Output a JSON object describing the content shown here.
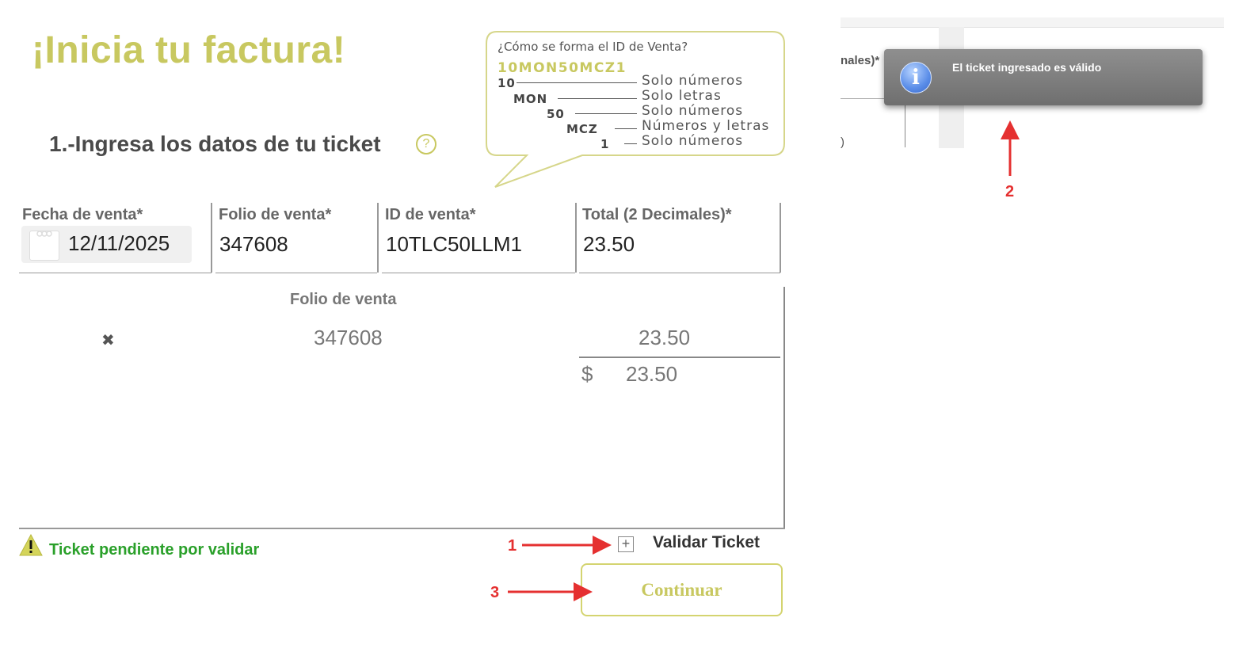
{
  "page": {
    "title": "¡Inicia tu factura!",
    "section_title": "1.-Ingresa los datos de tu ticket",
    "help_icon": "question-circle-icon"
  },
  "id_help": {
    "question": "¿Cómo se forma el ID de Venta?",
    "example": "10MON50MCZ1",
    "parts": [
      {
        "part": "10",
        "desc": "Solo números"
      },
      {
        "part": "MON",
        "desc": "Solo letras"
      },
      {
        "part": "50",
        "desc": "Solo números"
      },
      {
        "part": "MCZ",
        "desc": "Números y letras"
      },
      {
        "part": "1",
        "desc": "Solo números"
      }
    ]
  },
  "form": {
    "fecha": {
      "label": "Fecha de venta*",
      "value": "12/11/2025",
      "icon": "calendar-icon"
    },
    "folio": {
      "label": "Folio de venta*",
      "value": "347608"
    },
    "id_venta": {
      "label": "ID de venta*",
      "value": "10TLC50LLM1"
    },
    "total": {
      "label": "Total (2 Decimales)*",
      "value": "23.50"
    }
  },
  "table": {
    "header_folio": "Folio de venta",
    "rows": [
      {
        "delete_icon": "close-icon",
        "folio": "347608",
        "total": "23.50"
      }
    ],
    "sum_currency": "$",
    "sum_total": "23.50"
  },
  "status": {
    "icon": "warning-icon",
    "text": "Ticket pendiente por validar"
  },
  "actions": {
    "validate_icon": "plus-square-icon",
    "validate_label": "Validar Ticket",
    "continue_label": "Continuar"
  },
  "annotations": {
    "one": "1",
    "two": "2",
    "three": "3",
    "color": "#e53030"
  },
  "right_panel": {
    "partial_label": "nales)*",
    "partial_paren": ")",
    "toast_icon": "info-icon",
    "toast_message": "El ticket ingresado es válido"
  },
  "colors": {
    "accent": "#c8c860",
    "status_green": "#2aa02a",
    "toast_bg": "#7f7f7f"
  }
}
